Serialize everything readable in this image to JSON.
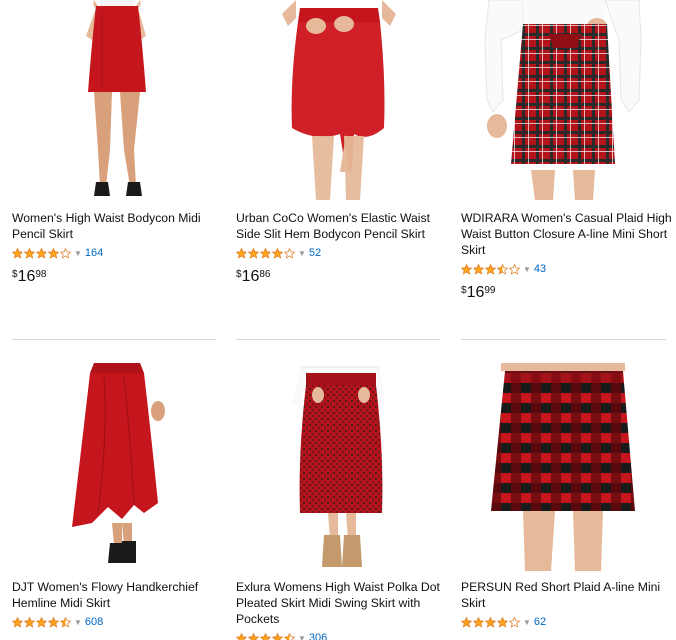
{
  "products": [
    {
      "title": "Women's High Waist Bodycon Midi Pencil Skirt",
      "rating": 4.0,
      "review_count": "164",
      "price": {
        "symbol": "$",
        "whole": "16",
        "fraction": "98"
      }
    },
    {
      "title": "Urban CoCo Women's Elastic Waist Side Slit Hem Bodycon Pencil Skirt",
      "rating": 4.0,
      "review_count": "52",
      "price": {
        "symbol": "$",
        "whole": "16",
        "fraction": "86"
      }
    },
    {
      "title": "WDIRARA Women's Casual Plaid High Waist Button Closure A-line Mini Short Skirt",
      "rating": 3.5,
      "review_count": "43",
      "price": {
        "symbol": "$",
        "whole": "16",
        "fraction": "99"
      }
    },
    {
      "title": "DJT Women's Flowy Handkerchief Hemline Midi Skirt",
      "rating": 4.5,
      "review_count": "608"
    },
    {
      "title": "Exlura Womens High Waist Polka Dot Pleated Skirt Midi Swing Skirt with Pockets",
      "rating": 4.5,
      "review_count": "306"
    },
    {
      "title": "PERSUN Red Short Plaid A-line Mini Skirt",
      "rating": 4.0,
      "review_count": "62"
    }
  ],
  "colors": {
    "star": "#ffa41c",
    "link": "#0066c0",
    "divider": "#d5d9d9",
    "skirt_red": "#c4161c"
  }
}
